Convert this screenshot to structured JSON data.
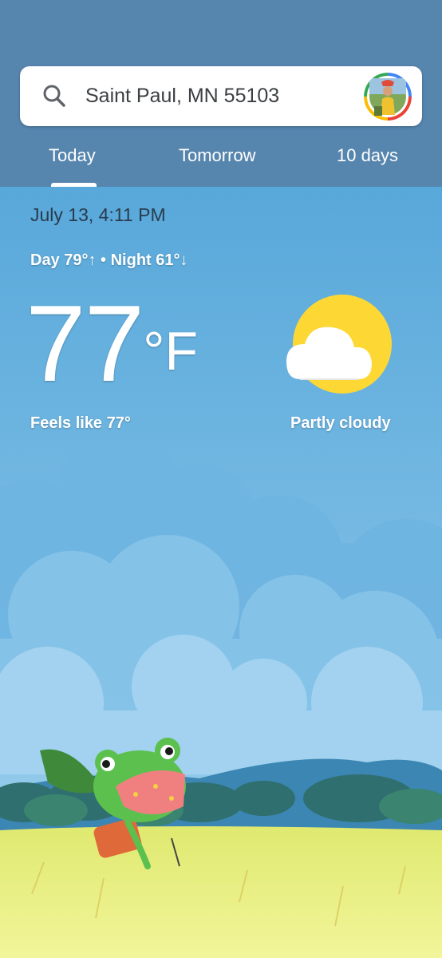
{
  "search": {
    "location": "Saint Paul, MN 55103"
  },
  "tabs": [
    {
      "label": "Today",
      "selected": true
    },
    {
      "label": "Tomorrow"
    },
    {
      "label": "10 days"
    }
  ],
  "weather": {
    "date_time": "July 13, 4:11 PM",
    "day_night": "Day 79°↑ • Night 61°↓",
    "temperature": "77",
    "unit": "°F",
    "feels_like": "Feels like 77°",
    "condition": "Partly cloudy",
    "condition_icon": "partly-cloudy-icon"
  },
  "colors": {
    "header": "#5685ae",
    "sky": "#5ba9d9",
    "grass": "#e6ee7a",
    "sun": "#fdd835"
  }
}
